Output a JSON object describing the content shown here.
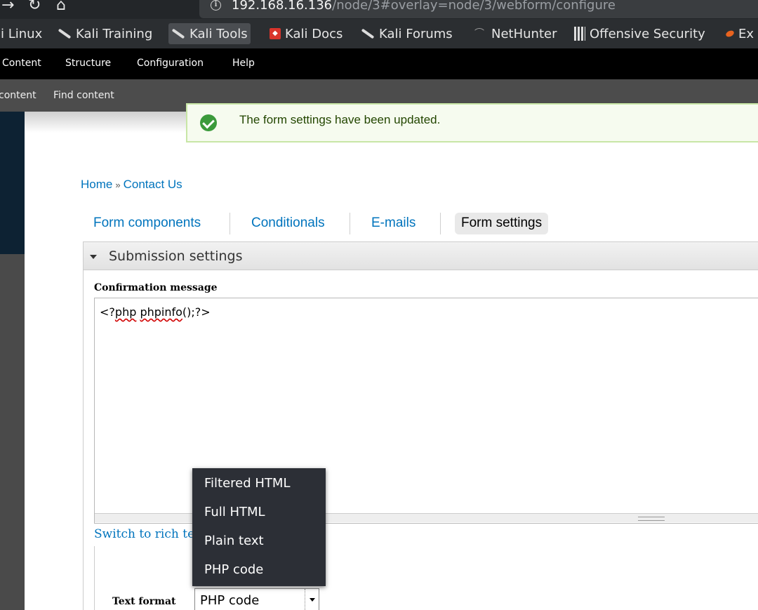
{
  "browser": {
    "url_host": "192.168.16.136",
    "url_path": "/node/3#overlay=node/3/webform/configure",
    "bookmarks": [
      {
        "label": "li Linux"
      },
      {
        "label": "Kali Training"
      },
      {
        "label": "Kali Tools"
      },
      {
        "label": "Kali Docs"
      },
      {
        "label": "Kali Forums"
      },
      {
        "label": "NetHunter"
      },
      {
        "label": "Offensive Security"
      },
      {
        "label": "Ex"
      }
    ]
  },
  "admin_menu": {
    "items": [
      {
        "label": "Content"
      },
      {
        "label": "Structure"
      },
      {
        "label": "Configuration"
      },
      {
        "label": "Help"
      }
    ]
  },
  "shortcuts": {
    "items": [
      {
        "label": "content"
      },
      {
        "label": "Find content"
      }
    ]
  },
  "status": {
    "message": "The form settings have been updated."
  },
  "breadcrumb": {
    "home": "Home",
    "separator": "»",
    "current": "Contact Us"
  },
  "tabs": [
    {
      "label": "Form components"
    },
    {
      "label": "Conditionals"
    },
    {
      "label": "E-mails"
    },
    {
      "label": "Form settings",
      "active": true
    }
  ],
  "fieldset": {
    "legend": "Submission settings",
    "confirmation_label": "Confirmation message",
    "confirmation_prefix": "<?",
    "confirmation_word1": "php",
    "confirmation_space": " ",
    "confirmation_word2": "phpinfo",
    "confirmation_suffix": "();?>",
    "switch_link": "Switch to rich tex",
    "text_format_label": "Text format",
    "text_format_selected": "PHP code"
  },
  "dropdown": {
    "options": [
      {
        "label": "Filtered HTML"
      },
      {
        "label": "Full HTML"
      },
      {
        "label": "Plain text"
      },
      {
        "label": "PHP code"
      }
    ]
  },
  "colors": {
    "link": "#0074bd",
    "admin_bar": "#000000",
    "shortcut_bar": "#4c4c4c",
    "status_border": "#c8e6a6",
    "dropdown_bg": "#2c2f36"
  }
}
